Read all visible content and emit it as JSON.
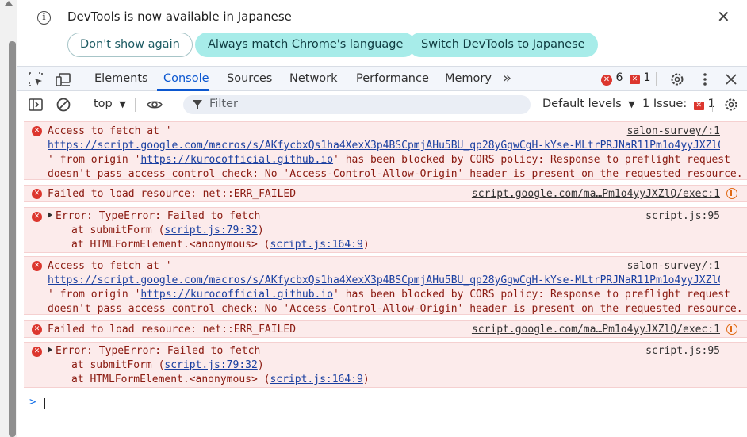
{
  "infobar": {
    "message": "DevTools is now available in Japanese",
    "buttons": {
      "dont_show": "Don't show again",
      "always_match": "Always match Chrome's language",
      "switch": "Switch DevTools to Japanese"
    },
    "close_glyph": "✕"
  },
  "tabs": {
    "elements": "Elements",
    "console": "Console",
    "sources": "Sources",
    "network": "Network",
    "performance": "Performance",
    "memory": "Memory",
    "more": "»"
  },
  "status": {
    "errors": "6",
    "warnings": "1"
  },
  "toolbar": {
    "context": "top",
    "filter_placeholder": "Filter",
    "levels": "Default levels",
    "issues_label": "1 Issue:",
    "issues_count": "1"
  },
  "messages": [
    {
      "lines": [
        "Access to fetch at '",
        "https://script.google.com/macros/s/AKfycbxQs1ha4XexX3p4BSCpmjAHu5BU_qp28yGgwCgH-kYse-MLtrPRJNaR11Pm1o4yyJXZlQ/e…",
        "' from origin '",
        "https://kurocofficial.github.io",
        "' has been blocked by CORS policy: Response to preflight request",
        "doesn't pass access control check: No 'Access-Control-Allow-Origin' header is present on the requested resource."
      ],
      "source": "salon-survey/:1"
    },
    {
      "text": "Failed to load resource: net::ERR_FAILED",
      "source": "script.google.com/ma…Pm1o4yyJXZlQ/exec:1"
    },
    {
      "lines": [
        "Error: TypeError: Failed to fetch",
        "at submitForm (",
        "script.js:79:32",
        ")",
        "at HTMLFormElement.<anonymous> (",
        "script.js:164:9",
        ")"
      ],
      "source": "script.js:95"
    },
    {
      "lines": [
        "Access to fetch at '",
        "https://script.google.com/macros/s/AKfycbxQs1ha4XexX3p4BSCpmjAHu5BU_qp28yGgwCgH-kYse-MLtrPRJNaR11Pm1o4yyJXZlQ/e…",
        "' from origin '",
        "https://kurocofficial.github.io",
        "' has been blocked by CORS policy: Response to preflight request",
        "doesn't pass access control check: No 'Access-Control-Allow-Origin' header is present on the requested resource."
      ],
      "source": "salon-survey/:1"
    },
    {
      "text": "Failed to load resource: net::ERR_FAILED",
      "source": "script.google.com/ma…Pm1o4yyJXZlQ/exec:1"
    },
    {
      "lines": [
        "Error: TypeError: Failed to fetch",
        "at submitForm (",
        "script.js:79:32",
        ")",
        "at HTMLFormElement.<anonymous> (",
        "script.js:164:9",
        ")"
      ],
      "source": "script.js:95"
    }
  ],
  "prompt": {
    "glyph": ">"
  },
  "colors": {
    "accent": "#0b57d0",
    "error": "#dc362e",
    "error_bg": "#fcebeb",
    "pill_bg": "#a7ece9"
  }
}
